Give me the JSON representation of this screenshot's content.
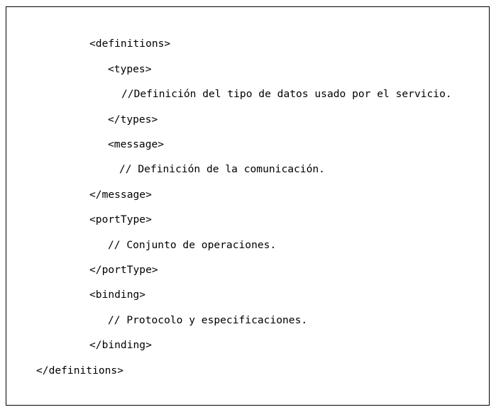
{
  "code": {
    "lines": [
      "<definitions>",
      "<types>",
      "//Definición del tipo de datos usado por el servicio.",
      "</types>",
      "<message>",
      "// Definición de la comunicación.",
      "</message>",
      "<portType>",
      "// Conjunto de operaciones.",
      "</portType>",
      "<binding>",
      "// Protocolo y especificaciones.",
      "</binding>",
      "</definitions>"
    ]
  },
  "colors": {
    "text": "#000000",
    "border": "#000000",
    "background": "#ffffff"
  }
}
